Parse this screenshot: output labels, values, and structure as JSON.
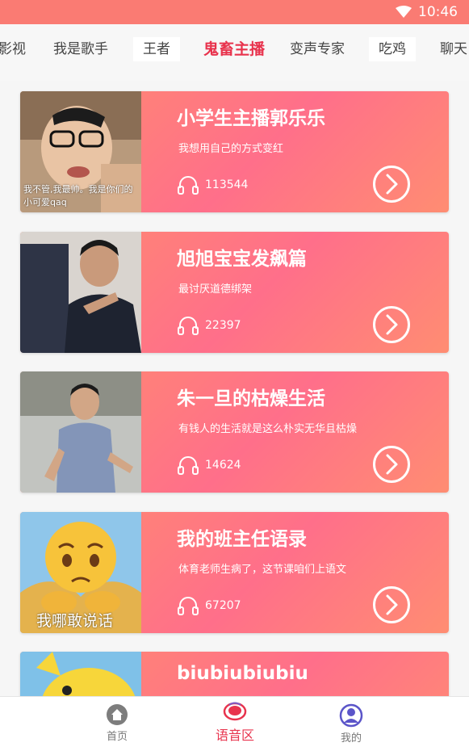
{
  "status": {
    "time": "10:46"
  },
  "tabs": [
    {
      "label": "影视"
    },
    {
      "label": "我是歌手"
    },
    {
      "label": "王者"
    },
    {
      "label": "鬼畜主播",
      "active": true
    },
    {
      "label": "变声专家"
    },
    {
      "label": "吃鸡"
    },
    {
      "label": "聊天"
    }
  ],
  "cards": [
    {
      "title": "小学生主播郭乐乐",
      "desc": "我想用自己的方式变红",
      "plays": "113544",
      "caption": "我不管,我最帅。我是你们的小可爱qaq"
    },
    {
      "title": "旭旭宝宝发飙篇",
      "desc": "最讨厌道德绑架",
      "plays": "22397",
      "caption": ""
    },
    {
      "title": "朱一旦的枯燥生活",
      "desc": "有钱人的生活就是这么朴实无华且枯燥",
      "plays": "14624",
      "caption": ""
    },
    {
      "title": "我的班主任语录",
      "desc": "体育老师生病了，这节课咱们上语文",
      "plays": "67207",
      "caption": "我哪敢说话"
    },
    {
      "title": "biubiubiubiu",
      "desc": "",
      "plays": "",
      "caption": ""
    }
  ],
  "nav": [
    {
      "label": "首页",
      "icon": "home-icon"
    },
    {
      "label": "语音区",
      "icon": "voice-icon",
      "active": true
    },
    {
      "label": "我的",
      "icon": "profile-icon"
    }
  ],
  "colors": {
    "accent": "#e8334d",
    "status_bar": "#fa7b73",
    "card_start": "#ff8c6f",
    "card_mid": "#ff6f8a"
  }
}
